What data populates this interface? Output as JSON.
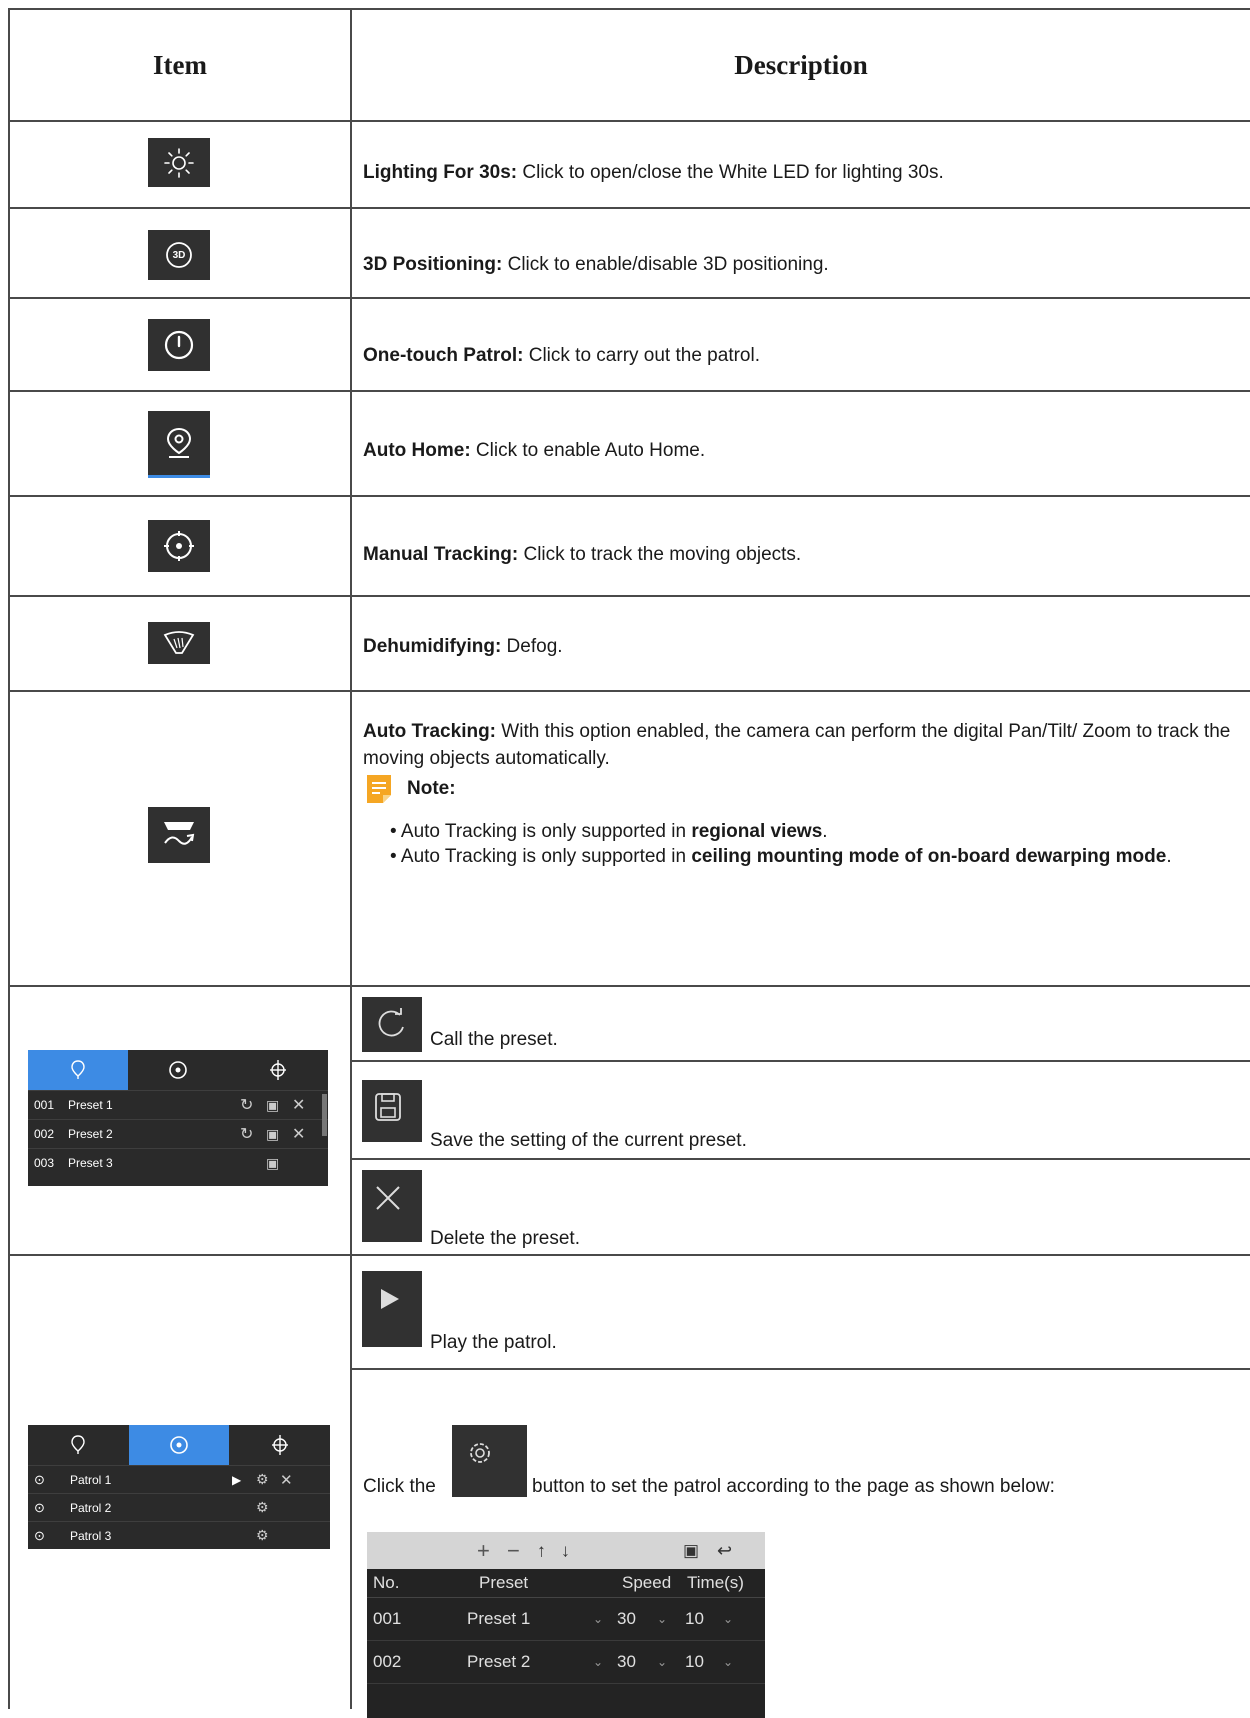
{
  "header": {
    "item": "Item",
    "description": "Description"
  },
  "rows": {
    "lighting": {
      "label": "Lighting For 30s:",
      "text": " Click to open/close the White LED for lighting 30s."
    },
    "positioning3d": {
      "label": "3D Positioning:",
      "text": " Click to enable/disable 3D positioning.",
      "icon_text": "3D"
    },
    "patrol": {
      "label": "One-touch Patrol:",
      "text": " Click to carry out the patrol."
    },
    "autohome": {
      "label": "Auto Home:",
      "text": " Click to enable Auto Home."
    },
    "manualtracking": {
      "label": "Manual Tracking:",
      "text": " Click to track the moving objects."
    },
    "dehumidifying": {
      "label": "Dehumidifying:",
      "text": " Defog."
    },
    "autotracking": {
      "label": "Auto Tracking:",
      "text": " With this option enabled, the camera can perform the digital Pan/Tilt/ Zoom to track the moving objects automatically.",
      "note_title": "Note:",
      "bullet1_pre": "Auto Tracking is only supported in ",
      "bullet1_bold": "regional views",
      "bullet1_post": ".",
      "bullet2_pre": "Auto Tracking is only supported in ",
      "bullet2_bold": "ceiling mounting mode of on-board dewarping mode",
      "bullet2_post": "."
    }
  },
  "preset": {
    "call_text": "Call the preset.",
    "save_text": "Save the setting of the current preset.",
    "delete_text": "Delete the preset.",
    "list": [
      {
        "no": "001",
        "name": "Preset 1"
      },
      {
        "no": "002",
        "name": "Preset 2"
      },
      {
        "no": "003",
        "name": "Preset 3"
      }
    ]
  },
  "patrol_section": {
    "play_text": "Play the patrol.",
    "click_the": "Click the",
    "set_text": "button to set the patrol according to the page as shown below:",
    "list": [
      {
        "name": "Patrol 1"
      },
      {
        "name": "Patrol 2"
      },
      {
        "name": "Patrol 3"
      }
    ],
    "table": {
      "headers": {
        "no": "No.",
        "preset": "Preset",
        "speed": "Speed",
        "time": "Time(s)"
      },
      "rows": [
        {
          "no": "001",
          "preset": "Preset 1",
          "speed": "30",
          "time": "10"
        },
        {
          "no": "002",
          "preset": "Preset 2",
          "speed": "30",
          "time": "10"
        }
      ]
    }
  },
  "colors": {
    "accent": "#3d8be4",
    "icon_bg": "#303030",
    "note": "#f5a623"
  }
}
